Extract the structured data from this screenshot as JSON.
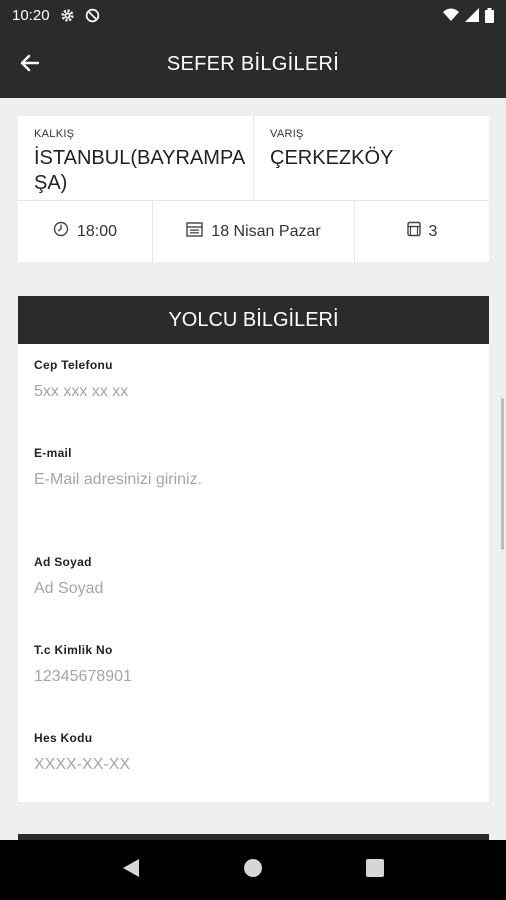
{
  "status_bar": {
    "time": "10:20",
    "icons": [
      "settings-icon",
      "dnd-icon",
      "wifi-icon",
      "signal-icon",
      "battery-icon"
    ]
  },
  "header": {
    "title": "SEFER BİLGİLERİ",
    "back_icon": "arrow-back-icon"
  },
  "route": {
    "from_label": "KALKIŞ",
    "from_value": "İSTANBUL(BAYRAMPAŞA)",
    "to_label": "VARIŞ",
    "to_value": "ÇERKEZKÖY",
    "time": "18:00",
    "date": "18 Nisan Pazar",
    "seat": "3"
  },
  "passenger": {
    "title": "YOLCU BİLGİLERİ",
    "fields": [
      {
        "label": "Cep Telefonu",
        "placeholder": "5xx xxx xx xx",
        "value": ""
      },
      {
        "label": "E-mail",
        "placeholder": "E-Mail adresinizi giriniz.",
        "value": ""
      },
      {
        "label": "Ad Soyad",
        "placeholder": "Ad Soyad",
        "value": ""
      },
      {
        "label": "T.c Kimlik No",
        "placeholder": "12345678901",
        "value": ""
      },
      {
        "label": "Hes Kodu",
        "placeholder": "XXXX-XX-XX",
        "value": ""
      }
    ]
  },
  "colors": {
    "header_bg": "#2b2b2b",
    "page_bg": "#efefef",
    "placeholder": "#a5a5a5"
  }
}
